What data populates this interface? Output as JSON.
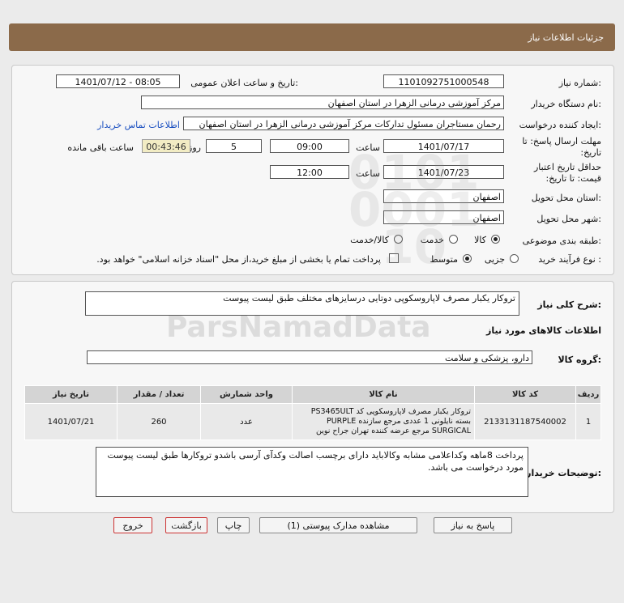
{
  "header": {
    "title": "جزئیات اطلاعات نیاز"
  },
  "form": {
    "need_number_label": "شماره نیاز:",
    "need_number": "1101092751000548",
    "announce_label": "تاریخ و ساعت اعلان عمومی:",
    "announce_value": "1401/07/12 - 08:05",
    "buyer_org_label": "نام دستگاه خریدار:",
    "buyer_org": "مرکز آموزشی درمانی الزهرا در استان اصفهان",
    "requester_label": "ایجاد کننده درخواست:",
    "requester": "رحمان مستاجران مسئول تداركات مرکز آموزشی درمانی الزهرا در استان اصفهان",
    "contact_link": "اطلاعات تماس خریدار",
    "deadline_label": "مهلت ارسال پاسخ: تا تاریخ:",
    "deadline_date": "1401/07/17",
    "time_label": "ساعت",
    "deadline_time": "09:00",
    "days_value": "5",
    "days_and_label": "روز و",
    "remaining_time": "00:43:46",
    "remaining_label": "ساعت باقی مانده",
    "validity_label": "حداقل تاریخ اعتبار قیمت: تا تاریخ:",
    "validity_date": "1401/07/23",
    "validity_time": "12:00",
    "province_label": "استان محل تحویل:",
    "province": "اصفهان",
    "city_label": "شهر محل تحویل:",
    "city": "اصفهان",
    "category_label": "طبقه بندی موضوعی:",
    "category_options": [
      "کالا",
      "خدمت",
      "کالا/خدمت"
    ],
    "process_label": "نوع فرآیند خرید :",
    "process_options": [
      "جزیی",
      "متوسط"
    ],
    "payment_note": "پرداخت تمام یا بخشی از مبلغ خرید،از محل \"اسناد خزانه اسلامی\" خواهد بود."
  },
  "summary": {
    "label": "شرح کلی نیاز:",
    "text": "تروکار یکبار مصرف لاپاروسکوپی دوتایی درسایزهای مختلف طبق لیست پیوست",
    "goods_info_title": "اطلاعات کالاهای مورد نیاز",
    "goods_group_label": "گروه کالا:",
    "goods_group": "دارو، پزشکی و سلامت"
  },
  "table": {
    "headers": [
      "ردیف",
      "کد کالا",
      "نام کالا",
      "واحد شمارش",
      "تعداد / مقدار",
      "تاریخ نیاز"
    ],
    "rows": [
      {
        "row": "1",
        "code": "2133131187540002",
        "name": "تروکار یکبار مصرف لاپاروسکوپی کد PS3465ULT بسته نایلونی 1 عددی مرجع سازنده PURPLE SURGICAL مرجع عرضه کننده تهران جراح نوین",
        "unit": "عدد",
        "qty": "260",
        "date": "1401/07/21"
      }
    ]
  },
  "buyer_notes": {
    "label": "توضیحات خریدار:",
    "text": "پرداخت 8ماهه وکداعلامی مشابه وکالاباید دارای برچسب اصالت وکدآی آرسی باشدو تروکارها طبق لیست پیوست مورد درخواست می باشد."
  },
  "buttons": {
    "reply": "پاسخ به نیاز",
    "attachments": "مشاهده مدارک پیوستی (1)",
    "print": "چاپ",
    "back": "بازگشت",
    "exit": "خروج"
  },
  "colors": {
    "title_bar": "#8b6a4a",
    "link": "#1a4fc0",
    "timer_bg": "#f2ecc4"
  }
}
